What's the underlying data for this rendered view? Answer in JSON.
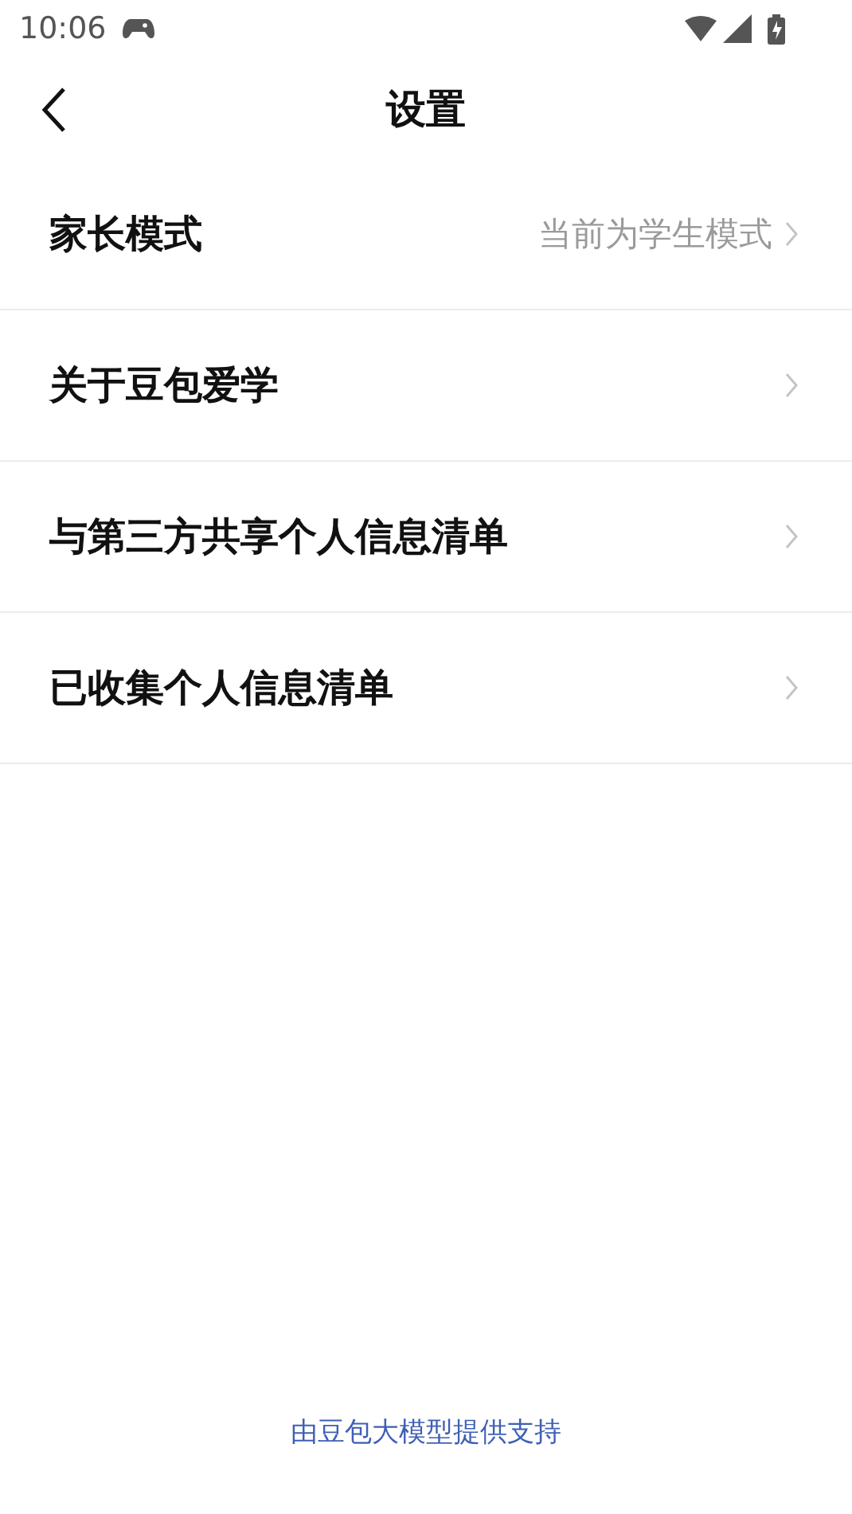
{
  "status_bar": {
    "time": "10:06"
  },
  "header": {
    "title": "设置"
  },
  "rows": [
    {
      "label": "家长模式",
      "value": "当前为学生模式"
    },
    {
      "label": "关于豆包爱学"
    },
    {
      "label": "与第三方共享个人信息清单"
    },
    {
      "label": "已收集个人信息清单"
    }
  ],
  "footer": {
    "text": "由豆包大模型提供支持"
  }
}
